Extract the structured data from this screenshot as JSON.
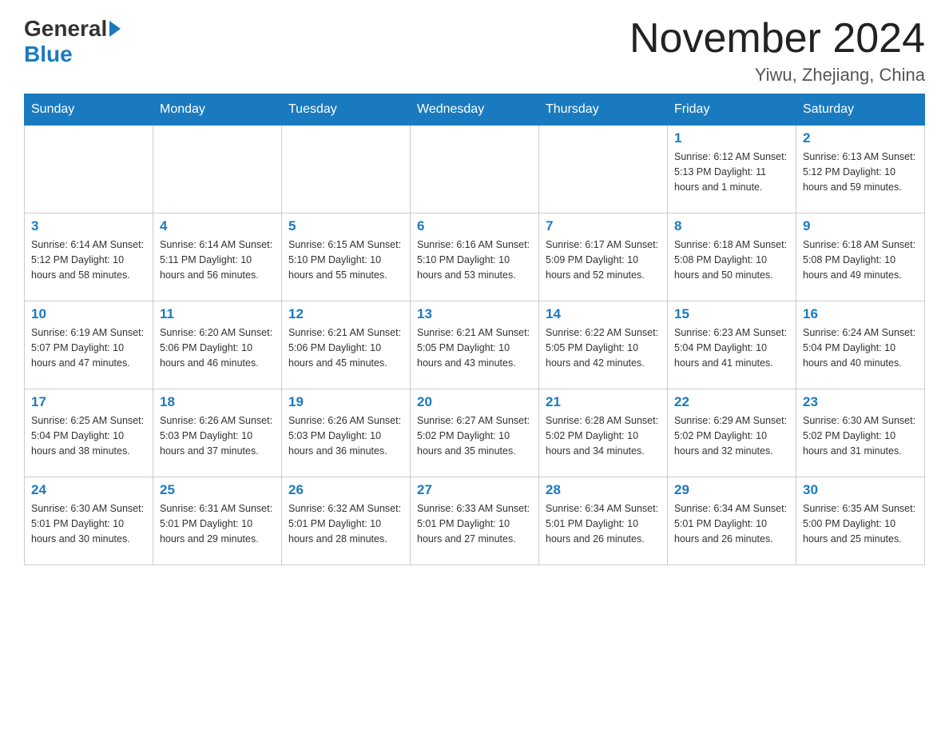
{
  "logo": {
    "general": "General",
    "blue": "Blue"
  },
  "header": {
    "month": "November 2024",
    "location": "Yiwu, Zhejiang, China"
  },
  "days_of_week": [
    "Sunday",
    "Monday",
    "Tuesday",
    "Wednesday",
    "Thursday",
    "Friday",
    "Saturday"
  ],
  "weeks": [
    [
      {
        "day": "",
        "info": ""
      },
      {
        "day": "",
        "info": ""
      },
      {
        "day": "",
        "info": ""
      },
      {
        "day": "",
        "info": ""
      },
      {
        "day": "",
        "info": ""
      },
      {
        "day": "1",
        "info": "Sunrise: 6:12 AM\nSunset: 5:13 PM\nDaylight: 11 hours and 1 minute."
      },
      {
        "day": "2",
        "info": "Sunrise: 6:13 AM\nSunset: 5:12 PM\nDaylight: 10 hours and 59 minutes."
      }
    ],
    [
      {
        "day": "3",
        "info": "Sunrise: 6:14 AM\nSunset: 5:12 PM\nDaylight: 10 hours and 58 minutes."
      },
      {
        "day": "4",
        "info": "Sunrise: 6:14 AM\nSunset: 5:11 PM\nDaylight: 10 hours and 56 minutes."
      },
      {
        "day": "5",
        "info": "Sunrise: 6:15 AM\nSunset: 5:10 PM\nDaylight: 10 hours and 55 minutes."
      },
      {
        "day": "6",
        "info": "Sunrise: 6:16 AM\nSunset: 5:10 PM\nDaylight: 10 hours and 53 minutes."
      },
      {
        "day": "7",
        "info": "Sunrise: 6:17 AM\nSunset: 5:09 PM\nDaylight: 10 hours and 52 minutes."
      },
      {
        "day": "8",
        "info": "Sunrise: 6:18 AM\nSunset: 5:08 PM\nDaylight: 10 hours and 50 minutes."
      },
      {
        "day": "9",
        "info": "Sunrise: 6:18 AM\nSunset: 5:08 PM\nDaylight: 10 hours and 49 minutes."
      }
    ],
    [
      {
        "day": "10",
        "info": "Sunrise: 6:19 AM\nSunset: 5:07 PM\nDaylight: 10 hours and 47 minutes."
      },
      {
        "day": "11",
        "info": "Sunrise: 6:20 AM\nSunset: 5:06 PM\nDaylight: 10 hours and 46 minutes."
      },
      {
        "day": "12",
        "info": "Sunrise: 6:21 AM\nSunset: 5:06 PM\nDaylight: 10 hours and 45 minutes."
      },
      {
        "day": "13",
        "info": "Sunrise: 6:21 AM\nSunset: 5:05 PM\nDaylight: 10 hours and 43 minutes."
      },
      {
        "day": "14",
        "info": "Sunrise: 6:22 AM\nSunset: 5:05 PM\nDaylight: 10 hours and 42 minutes."
      },
      {
        "day": "15",
        "info": "Sunrise: 6:23 AM\nSunset: 5:04 PM\nDaylight: 10 hours and 41 minutes."
      },
      {
        "day": "16",
        "info": "Sunrise: 6:24 AM\nSunset: 5:04 PM\nDaylight: 10 hours and 40 minutes."
      }
    ],
    [
      {
        "day": "17",
        "info": "Sunrise: 6:25 AM\nSunset: 5:04 PM\nDaylight: 10 hours and 38 minutes."
      },
      {
        "day": "18",
        "info": "Sunrise: 6:26 AM\nSunset: 5:03 PM\nDaylight: 10 hours and 37 minutes."
      },
      {
        "day": "19",
        "info": "Sunrise: 6:26 AM\nSunset: 5:03 PM\nDaylight: 10 hours and 36 minutes."
      },
      {
        "day": "20",
        "info": "Sunrise: 6:27 AM\nSunset: 5:02 PM\nDaylight: 10 hours and 35 minutes."
      },
      {
        "day": "21",
        "info": "Sunrise: 6:28 AM\nSunset: 5:02 PM\nDaylight: 10 hours and 34 minutes."
      },
      {
        "day": "22",
        "info": "Sunrise: 6:29 AM\nSunset: 5:02 PM\nDaylight: 10 hours and 32 minutes."
      },
      {
        "day": "23",
        "info": "Sunrise: 6:30 AM\nSunset: 5:02 PM\nDaylight: 10 hours and 31 minutes."
      }
    ],
    [
      {
        "day": "24",
        "info": "Sunrise: 6:30 AM\nSunset: 5:01 PM\nDaylight: 10 hours and 30 minutes."
      },
      {
        "day": "25",
        "info": "Sunrise: 6:31 AM\nSunset: 5:01 PM\nDaylight: 10 hours and 29 minutes."
      },
      {
        "day": "26",
        "info": "Sunrise: 6:32 AM\nSunset: 5:01 PM\nDaylight: 10 hours and 28 minutes."
      },
      {
        "day": "27",
        "info": "Sunrise: 6:33 AM\nSunset: 5:01 PM\nDaylight: 10 hours and 27 minutes."
      },
      {
        "day": "28",
        "info": "Sunrise: 6:34 AM\nSunset: 5:01 PM\nDaylight: 10 hours and 26 minutes."
      },
      {
        "day": "29",
        "info": "Sunrise: 6:34 AM\nSunset: 5:01 PM\nDaylight: 10 hours and 26 minutes."
      },
      {
        "day": "30",
        "info": "Sunrise: 6:35 AM\nSunset: 5:00 PM\nDaylight: 10 hours and 25 minutes."
      }
    ]
  ]
}
